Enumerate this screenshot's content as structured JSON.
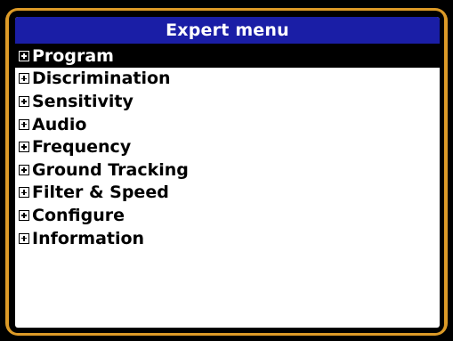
{
  "window": {
    "title": "Expert menu"
  },
  "menu": {
    "selected_index": 0,
    "expand_icon": "plus-box-icon",
    "items": [
      {
        "label": "Program"
      },
      {
        "label": "Discrimination"
      },
      {
        "label": "Sensitivity"
      },
      {
        "label": "Audio"
      },
      {
        "label": "Frequency"
      },
      {
        "label": "Ground Tracking"
      },
      {
        "label": "Filter & Speed"
      },
      {
        "label": "Configure"
      },
      {
        "label": "Information"
      }
    ]
  },
  "colors": {
    "bezel": "#dc9a27",
    "title_bar": "#1a1ea6",
    "selection": "#000000",
    "background": "#ffffff"
  }
}
